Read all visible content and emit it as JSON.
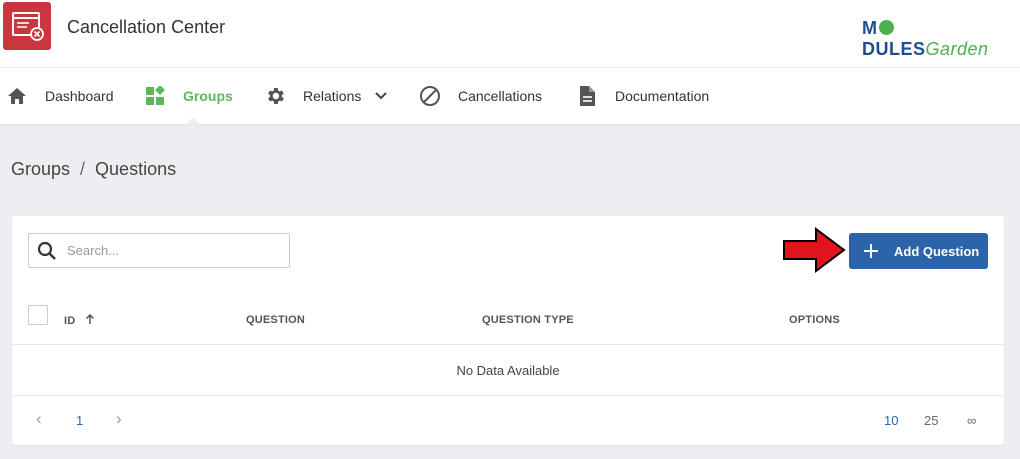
{
  "app": {
    "title": "Cancellation Center"
  },
  "brand": {
    "part1": "M",
    "part2": "DULES",
    "part3": "Garden"
  },
  "nav": [
    {
      "label": "Dashboard",
      "icon": "home-icon"
    },
    {
      "label": "Groups",
      "icon": "groups-icon",
      "active": true
    },
    {
      "label": "Relations",
      "icon": "gear-icon",
      "dropdown": true
    },
    {
      "label": "Cancellations",
      "icon": "cancel-circle-icon"
    },
    {
      "label": "Documentation",
      "icon": "document-icon"
    }
  ],
  "breadcrumb": {
    "parent": "Groups",
    "separator": "/",
    "current": "Questions"
  },
  "toolbar": {
    "search_placeholder": "Search...",
    "add_label": "Add Question"
  },
  "table": {
    "columns": [
      "ID",
      "QUESTION",
      "QUESTION TYPE",
      "OPTIONS"
    ],
    "sort_column": "ID",
    "empty_text": "No Data Available"
  },
  "pagination": {
    "prev": "‹",
    "current_page": "1",
    "next": "›",
    "page_sizes": [
      "10",
      "25",
      "∞"
    ],
    "selected_size": "10"
  },
  "colors": {
    "accent": "#2b64a8",
    "active_nav": "#5cb85c",
    "logo_bg": "#c9363e",
    "arrow": "#e1141b"
  }
}
